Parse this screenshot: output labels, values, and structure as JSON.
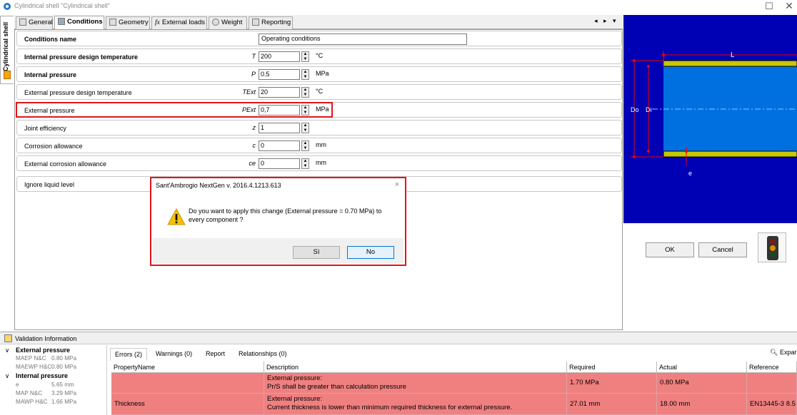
{
  "window": {
    "title": "Cylindrical shell \"Cylindrical shell\"",
    "side_tab": "Cylindrical shell"
  },
  "tabs": [
    {
      "label": "General",
      "icon": "general-tab-icon"
    },
    {
      "label": "Conditions",
      "icon": "conditions-tab-icon"
    },
    {
      "label": "Geometry",
      "icon": "geometry-tab-icon"
    },
    {
      "label": "External loads",
      "icon": "fx-icon",
      "prefix": "fx"
    },
    {
      "label": "Weight",
      "icon": "weight-icon"
    },
    {
      "label": "Reporting",
      "icon": "reporting-tab-icon"
    }
  ],
  "tab_nav": "◂ ▸ ▾",
  "conditions": {
    "name_label": "Conditions name",
    "name_value": "Operating conditions",
    "rows": [
      {
        "label": "Internal pressure design temperature",
        "symbol": "T",
        "value": "200",
        "unit": "°C",
        "bold": true
      },
      {
        "label": "Internal pressure",
        "symbol": "P",
        "value": "0.5",
        "unit": "MPa",
        "bold": true
      },
      {
        "label": "External pressure design temperature",
        "symbol": "TExt",
        "value": "20",
        "unit": "°C",
        "bold": false
      },
      {
        "label": "External pressure",
        "symbol": "PExt",
        "value": "0,7",
        "unit": "MPa",
        "bold": false
      },
      {
        "label": "Joint efficiency",
        "symbol": "z",
        "value": "1",
        "unit": "",
        "bold": false
      },
      {
        "label": "Corrosion allowance",
        "symbol": "c",
        "value": "0",
        "unit": "mm",
        "bold": false
      },
      {
        "label": "External corrosion allowance",
        "symbol": "ce",
        "value": "0",
        "unit": "mm",
        "bold": false
      }
    ],
    "liquid_label": "Ignore liquid level"
  },
  "drawing": {
    "L": "L",
    "Do": "Do",
    "Di": "Di",
    "e": "e",
    "bg": "#0000b4",
    "shell": "#0070e0",
    "wall": "#c8c800"
  },
  "buttons": {
    "ok": "OK",
    "cancel": "Cancel"
  },
  "dialog": {
    "title": "Sant'Ambrogio NextGen  v. 2016.4.1213.613",
    "message": "Do you want to apply this change (External pressure = 0.70 MPa) to every component ?",
    "yes": "Sì",
    "no": "No",
    "close": "×"
  },
  "validation": {
    "title": "Validation Information",
    "tree": [
      {
        "text": "External pressure",
        "kind": "head"
      },
      {
        "text": "MAEP N&C",
        "value": "0.80 MPa",
        "kind": "item"
      },
      {
        "text": "MAEWP H&C",
        "value": "0.80 MPa",
        "kind": "item"
      },
      {
        "text": "Internal pressure",
        "kind": "head"
      },
      {
        "text": "e",
        "value": "5.65 mm",
        "kind": "item"
      },
      {
        "text": "MAP N&C",
        "value": "3.29 MPa",
        "kind": "item"
      },
      {
        "text": "MAWP H&C",
        "value": "1.66 MPa",
        "kind": "item"
      }
    ],
    "tabs": [
      "Errors (2)",
      "Warnings (0)",
      "Report",
      "Relationships (0)"
    ],
    "expand": "Expar",
    "columns": [
      "PropertyName",
      "Description",
      "Required",
      "Actual",
      "Reference"
    ],
    "rows": [
      {
        "property": "",
        "desc1": "External pressure:",
        "desc2": "Pr/S shall be greater than calculation pressure",
        "required": "1.70 MPa",
        "actual": "0.80 MPa",
        "reference": ""
      },
      {
        "property": "Thickness",
        "desc1": "External pressure:",
        "desc2": "Current thickness is lower than minimum required thickness for external pressure.",
        "required": "27.01 mm",
        "actual": "18.00 mm",
        "reference": "EN13445-3 8.5"
      }
    ],
    "error_color": "#f08080"
  }
}
